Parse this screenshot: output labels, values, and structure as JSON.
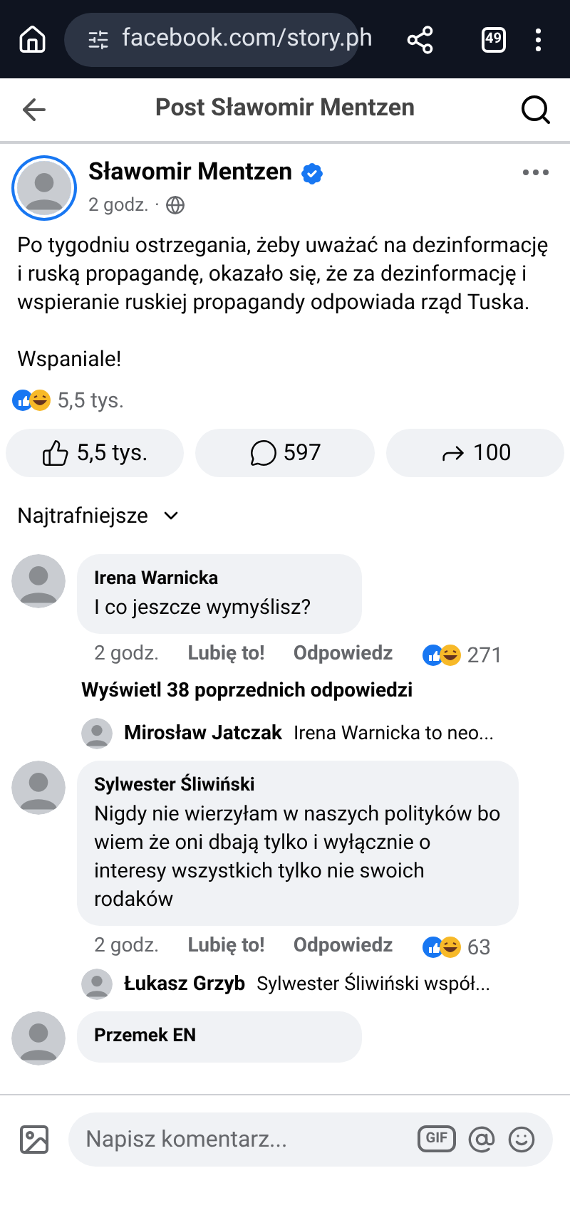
{
  "browser": {
    "url": "facebook.com/story.ph",
    "tab_count": "49"
  },
  "header": {
    "title": "Post Sławomir Mentzen"
  },
  "post": {
    "author": "Sławomir Mentzen",
    "verified": true,
    "time": "2 godz.",
    "separator": "·",
    "paragraphs": [
      "Po tygodniu ostrzegania, żeby uważać na dezinformację i ruską propagandę, okazało się, że za dezinformację i wspieranie ruskiej propagandy odpowiada rząd Tuska.",
      "Wspaniale!"
    ],
    "reaction_count": "5,5 tys."
  },
  "actions": [
    {
      "kind": "like",
      "label": "5,5 tys."
    },
    {
      "kind": "comment",
      "label": "597"
    },
    {
      "kind": "share",
      "label": "100"
    }
  ],
  "sort": {
    "label": "Najtrafniejsze"
  },
  "thread": [
    {
      "kind": "comment",
      "author": "Irena Warnicka",
      "text": "I co jeszcze wymyślisz?",
      "time": "2 godz.",
      "like": "Lubię to!",
      "reply": "Odpowiedz",
      "reactions": "271"
    },
    {
      "kind": "more",
      "text": "Wyświetl 38 poprzednich odpowiedzi"
    },
    {
      "kind": "reply",
      "author": "Mirosław Jatczak",
      "text": "Irena Warnicka to neo..."
    },
    {
      "kind": "comment",
      "author": "Sylwester Śliwiński",
      "text": "Nigdy nie wierzyłam w naszych polityków bo wiem że oni dbają tylko i wyłącznie o interesy wszystkich tylko nie swoich rodaków",
      "time": "2 godz.",
      "like": "Lubię to!",
      "reply": "Odpowiedz",
      "reactions": "63"
    },
    {
      "kind": "reply",
      "author": "Łukasz Grzyb",
      "text": "Sylwester Śliwiński współ..."
    },
    {
      "kind": "comment",
      "author": "Przemek EN"
    }
  ],
  "composer": {
    "placeholder": "Napisz komentarz...",
    "gif": "GIF"
  }
}
